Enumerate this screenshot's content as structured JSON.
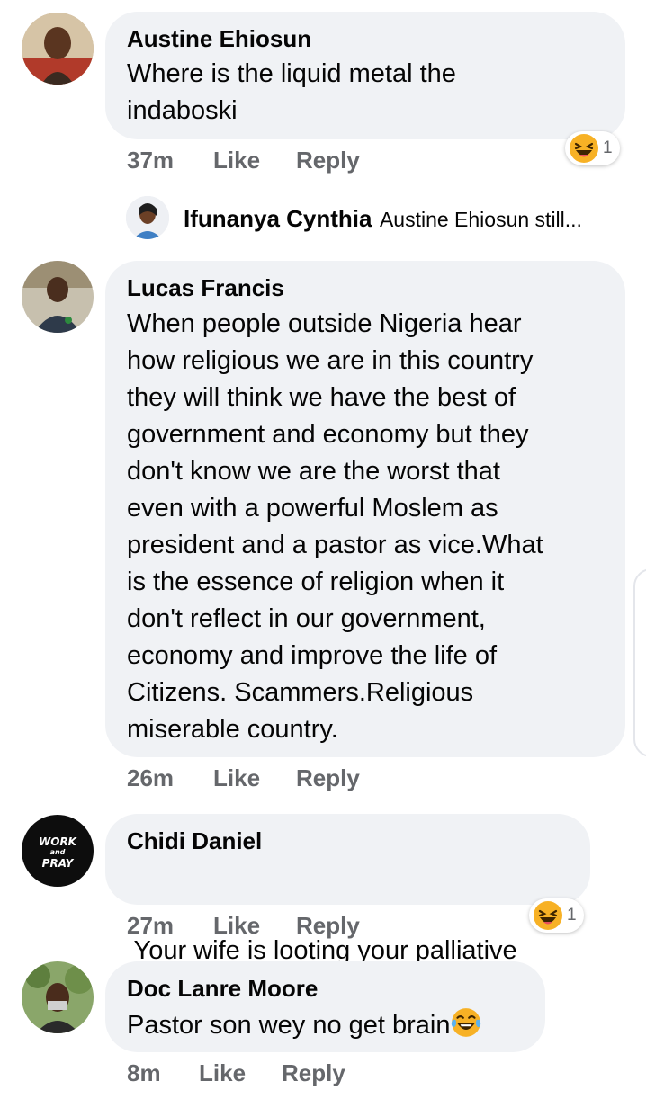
{
  "comments": [
    {
      "author": "Austine Ehiosun",
      "lines": [
        "Where is the liquid metal the",
        "indaboski"
      ],
      "time": "37m",
      "like_label": "Like",
      "reply_label": "Reply",
      "reaction": {
        "icon": "laughing-face-icon",
        "count": "1"
      },
      "reply_preview": {
        "author": "Ifunanya Cynthia",
        "snippet": "Austine Ehiosun still..."
      }
    },
    {
      "author": "Lucas Francis",
      "lines": [
        "When people outside Nigeria hear",
        "how religious we are in this country",
        "they will think we have the best of",
        "government and economy but they",
        "don't know we are the worst that",
        "even with a powerful Moslem as",
        "president and a pastor as vice.What",
        "is the essence of religion when it",
        "don't reflect in our government,",
        "economy and improve the life of",
        "Citizens. Scammers.Religious",
        "miserable country."
      ],
      "time": "26m",
      "like_label": "Like",
      "reply_label": "Reply"
    },
    {
      "author": "Chidi Daniel",
      "lines": [
        " Your wife is looting your palliative"
      ],
      "time": "27m",
      "like_label": "Like",
      "reply_label": "Reply",
      "reaction": {
        "icon": "laughing-face-icon",
        "count": "1"
      },
      "avatar_text": [
        "WORK",
        "and",
        "PRAY"
      ]
    },
    {
      "author": "Doc Lanre Moore",
      "lines": [
        "Pastor son wey no get brain"
      ],
      "emoji": "tears-of-joy-icon",
      "time": "8m",
      "like_label": "Like",
      "reply_label": "Reply"
    }
  ],
  "colors": {
    "bubble": "#f0f2f5",
    "meta_text": "#65676b",
    "reaction_yellow": "#f7b125"
  }
}
